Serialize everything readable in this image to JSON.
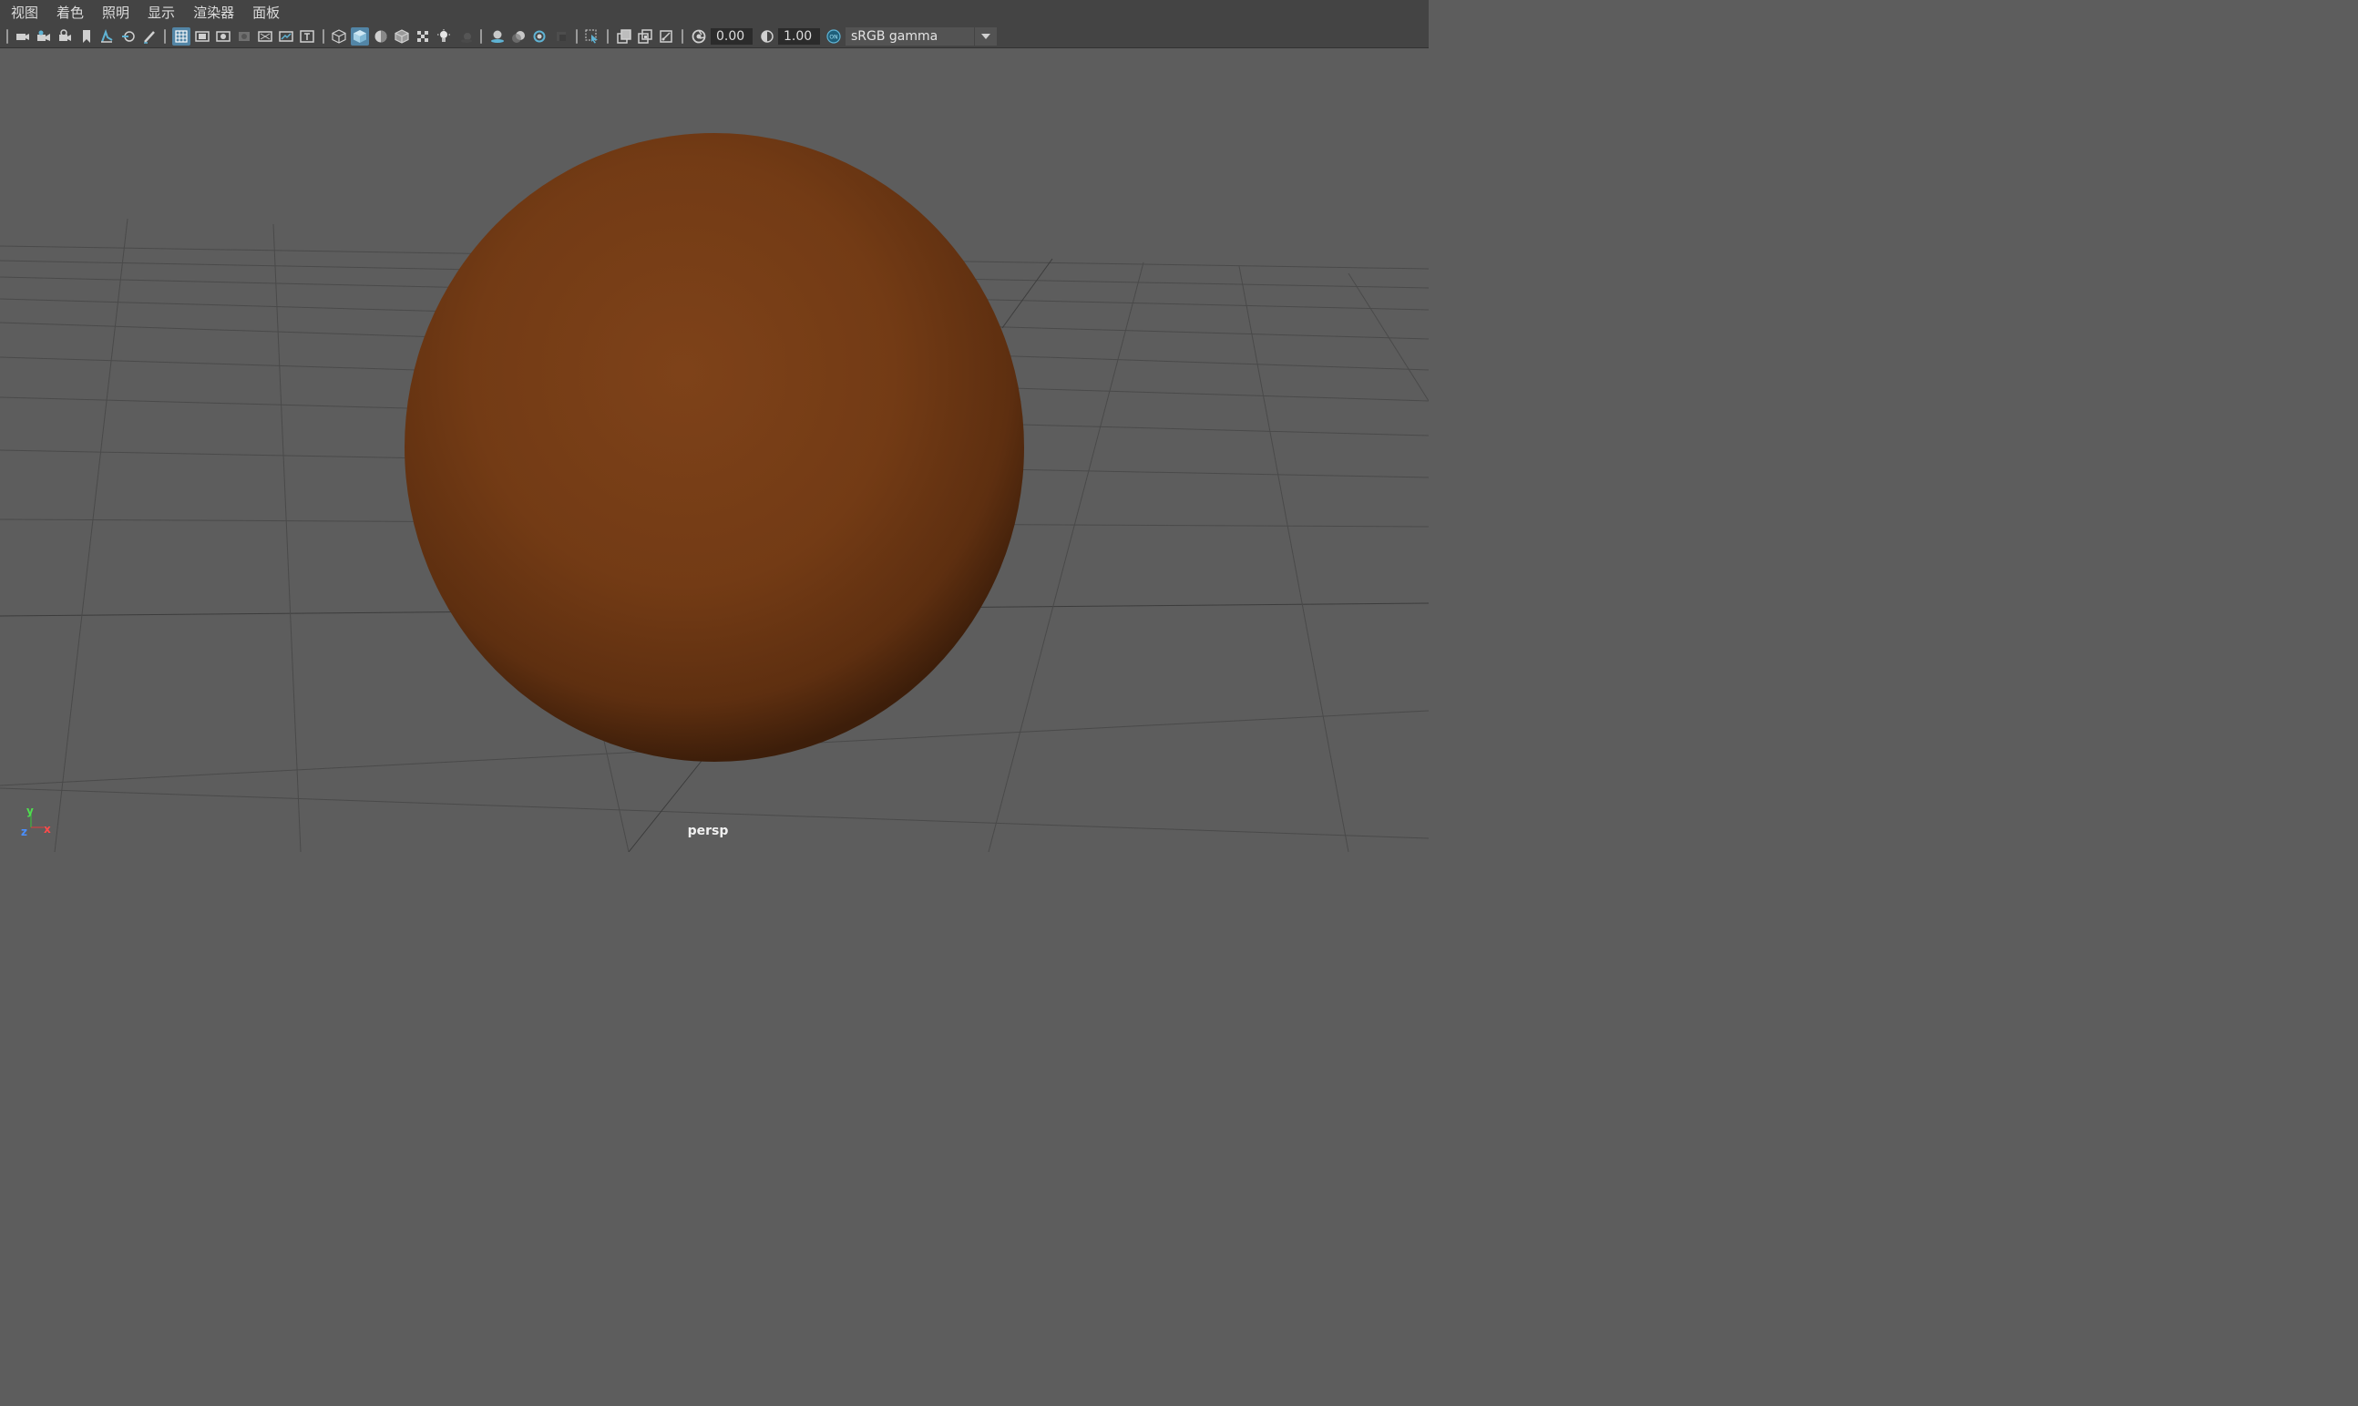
{
  "menubar": {
    "items": [
      "视图",
      "着色",
      "照明",
      "显示",
      "渲染器",
      "面板"
    ]
  },
  "toolbar": {
    "exposure_value": "0.00",
    "gamma_value": "1.00",
    "color_management_badge": "ON",
    "color_space": "sRGB gamma",
    "icons": [
      "select-camera-icon",
      "camera-attributes-icon",
      "camera-bookmark-icon",
      "image-plane-icon",
      "bookmark-icon",
      "2d-pan-zoom-icon",
      "grease-pencil-icon",
      "grid-icon",
      "film-gate-icon",
      "resolution-gate-icon",
      "gate-mask-icon",
      "field-chart-icon",
      "safe-action-icon",
      "safe-title-icon",
      "wireframe-icon",
      "smooth-shade-icon",
      "wireframe-on-shaded-icon",
      "textured-icon",
      "use-default-material-icon",
      "use-all-lights-icon",
      "shadows-icon",
      "screen-space-ambient-occlusion-icon",
      "motion-blur-icon",
      "multisample-anti-aliasing-icon",
      "depth-of-field-icon",
      "isolate-select-icon",
      "x-ray-icon",
      "x-ray-active-components-icon",
      "x-ray-joints-icon",
      "exposure-icon",
      "gamma-icon",
      "color-management-icon"
    ]
  },
  "viewport": {
    "camera_label": "persp",
    "sphere_color": "#7a3d16",
    "axes": {
      "y": "y",
      "z": "z",
      "x": "x"
    }
  },
  "colors": {
    "background": "#5d5d5d",
    "menubar": "#444444",
    "active_icon": "#5285a6",
    "grid_line": "#4a4a4a",
    "grid_axis": "#3a3a3a"
  }
}
